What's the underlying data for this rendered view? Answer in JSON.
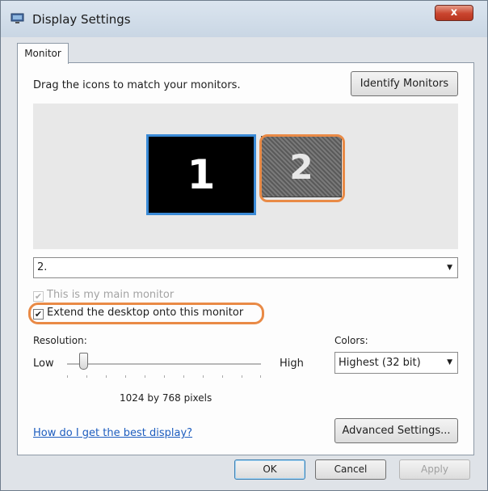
{
  "window": {
    "title": "Display Settings",
    "close_label": "x"
  },
  "tabs": [
    {
      "label": "Monitor"
    }
  ],
  "monitor_tab": {
    "instruction": "Drag the icons to match your monitors.",
    "identify_button": "Identify Monitors",
    "monitors": [
      {
        "label": "1",
        "selected": true
      },
      {
        "label": "2",
        "selected": false
      }
    ],
    "monitor_select": {
      "value": "2."
    },
    "main_monitor_checkbox": {
      "label": "This is my main monitor",
      "checked": true,
      "disabled": true
    },
    "extend_checkbox": {
      "label": "Extend the desktop onto this monitor",
      "checked": true
    },
    "resolution": {
      "label": "Resolution:",
      "low": "Low",
      "high": "High",
      "value": "1024 by 768 pixels",
      "slider_level": 0.13
    },
    "colors": {
      "label": "Colors:",
      "value": "Highest (32 bit)"
    },
    "help_link": "How do I get the best display?",
    "advanced_button": "Advanced Settings..."
  },
  "footer": {
    "ok": "OK",
    "cancel": "Cancel",
    "apply": "Apply"
  },
  "highlight_color": "#e98a46"
}
